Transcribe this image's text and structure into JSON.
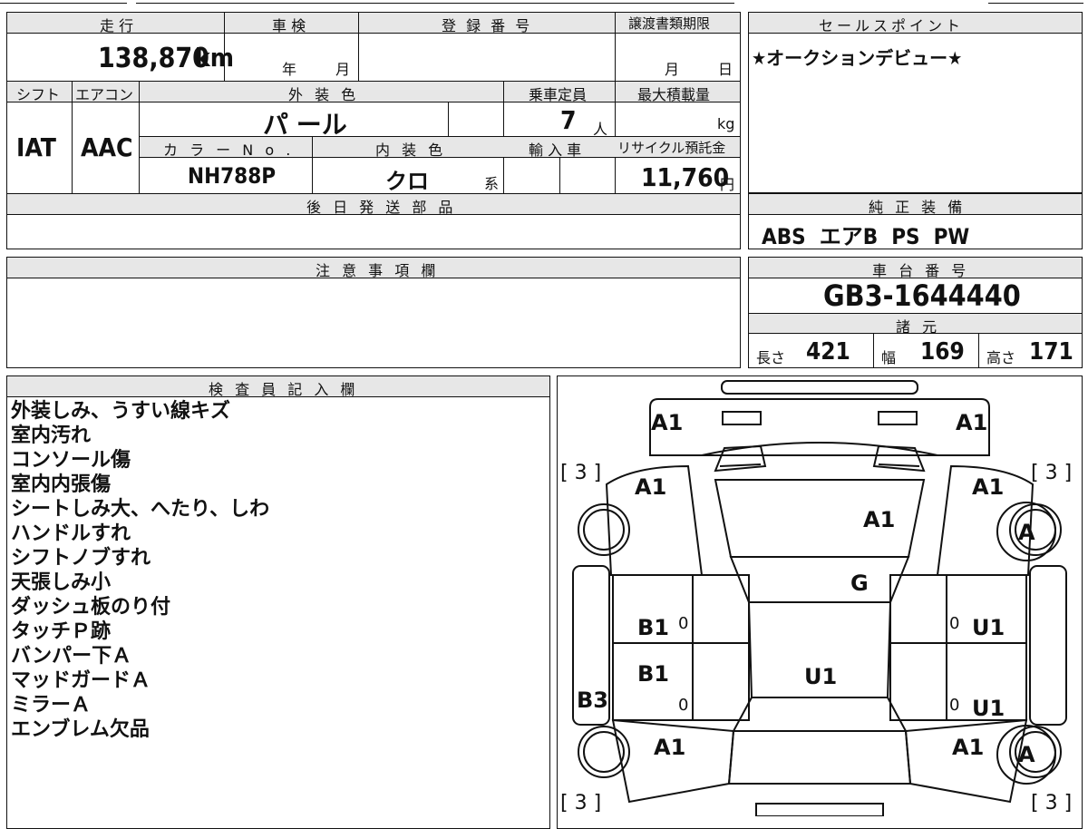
{
  "labels": {
    "mileage": "走 行",
    "inspection": "車 検",
    "registration_no": "登 録 番 号",
    "transfer_deadline": "譲渡書類期限",
    "sales_point": "セールスポイント",
    "shift": "シフト",
    "aircon": "エアコン",
    "exterior_color": "外 装 色",
    "capacity": "乗車定員",
    "max_load": "最大積載量",
    "color_no": "カ ラ ー N o .",
    "interior_color": "内 装 色",
    "import": "輸 入 車",
    "recycle_fee": "リサイクル預託金",
    "later_parts": "後 日 発 送 部 品",
    "factory_equipment": "純 正 装 備",
    "caution": "注 意 事 項 欄",
    "chassis_no": "車 台 番 号",
    "specs": "諸 元",
    "inspector_notes": "検 査 員 記 入 欄",
    "year": "年",
    "month": "月",
    "day": "日",
    "person": "人",
    "kg": "kg",
    "yen": "円",
    "system": "系",
    "length": "長さ",
    "width": "幅",
    "height": "高さ"
  },
  "values": {
    "mileage": "138,870",
    "mileage_unit": "km",
    "shift": "IAT",
    "aircon": "AAC",
    "exterior_color": "パ ール",
    "capacity": "7",
    "color_no": "NH788P",
    "interior_color": "クロ",
    "recycle_fee": "11,760",
    "sales_point": "★オークションデビュー★",
    "equipment": "ABS  エアB  PS  PW",
    "chassis_no": "GB3-1644440",
    "length": "421",
    "width": "169",
    "height": "171"
  },
  "notes": [
    "外装しみ、うすい線キズ",
    "室内汚れ",
    "コンソール傷",
    "室内内張傷",
    "シートしみ大、へたり、しわ",
    "ハンドルすれ",
    "シフトノブすれ",
    "天張しみ小",
    "ダッシュ板のり付",
    "タッチＰ跡",
    "バンパー下Ａ",
    "マッドガードＡ",
    "ミラーＡ",
    "エンブレム欠品"
  ],
  "diagram": {
    "front_left": "A1",
    "front_right": "A1",
    "fender_fl": "A1",
    "fender_fr": "A1",
    "hood": "A1",
    "windshield": "G",
    "door_fl": "B1",
    "door_fr": "U1",
    "door_rl": "B1",
    "door_rr": "U1",
    "roof": "U1",
    "sill_left": "B3",
    "rear_fender_l": "A1",
    "rear_fender_r": "A1",
    "wheel_fr": "A",
    "wheel_rr": "A",
    "tire_fl": "[ 3 ]",
    "tire_fr": "[ 3 ]",
    "tire_rl": "[ 3 ]",
    "tire_rr": "[ 3 ]",
    "zero_a": "0",
    "zero_b": "0",
    "zero_c": "0",
    "zero_d": "0"
  },
  "colors": {
    "header_bg": "#e7e7e7",
    "line": "#111111"
  }
}
